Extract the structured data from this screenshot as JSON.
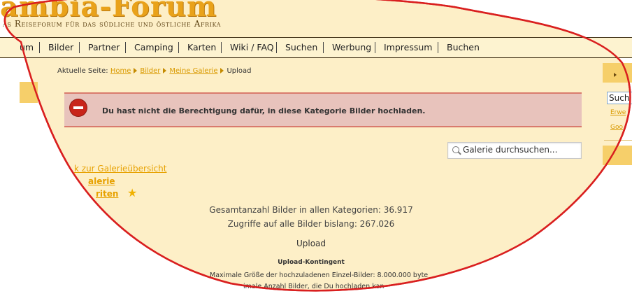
{
  "site": {
    "title": "ambia-Forum",
    "subtitle": "as Reiseforum für das südliche und östliche Afrika"
  },
  "nav": {
    "items": [
      "um",
      "Bilder",
      "Partner",
      "Camping",
      "Karten",
      "Wiki / FAQ",
      "Suchen",
      "Werbung",
      "Impressum",
      "Buchen"
    ]
  },
  "breadcrumb": {
    "prefix": "Aktuelle Seite:",
    "items": [
      "Home",
      "Bilder",
      "Meine Galerie"
    ],
    "current": "Upload"
  },
  "error": {
    "message": "Du hast nicht die Berechtigung dafür, in diese Kategorie Bilder hochladen."
  },
  "gallery_search": {
    "placeholder": "Galerie durchsuchen..."
  },
  "side_links": {
    "back": "k zur Galerieübersicht",
    "my_gallery": "alerie",
    "favorites": "riten"
  },
  "stats": {
    "total_images": "Gesamtanzahl Bilder in allen Kategorien: 36.917",
    "total_views": "Zugriffe auf alle Bilder bislang: 267.026"
  },
  "upload": {
    "heading": "Upload",
    "quota_heading": "Upload-Kontingent",
    "max_size": "Maximale Größe der hochzuladenen Einzel-Bilder: 8.000.000 byte",
    "max_count": "imale Anzahl Bilder, die Du hochladen kan"
  },
  "right_sidebar": {
    "search_value": "Such",
    "link1": "Erwe",
    "link2": "Goo"
  },
  "colors": {
    "background": "#fdefc7",
    "accent": "#e7a100",
    "outline": "#d91f1f",
    "error_bg": "#e8c3bc"
  }
}
